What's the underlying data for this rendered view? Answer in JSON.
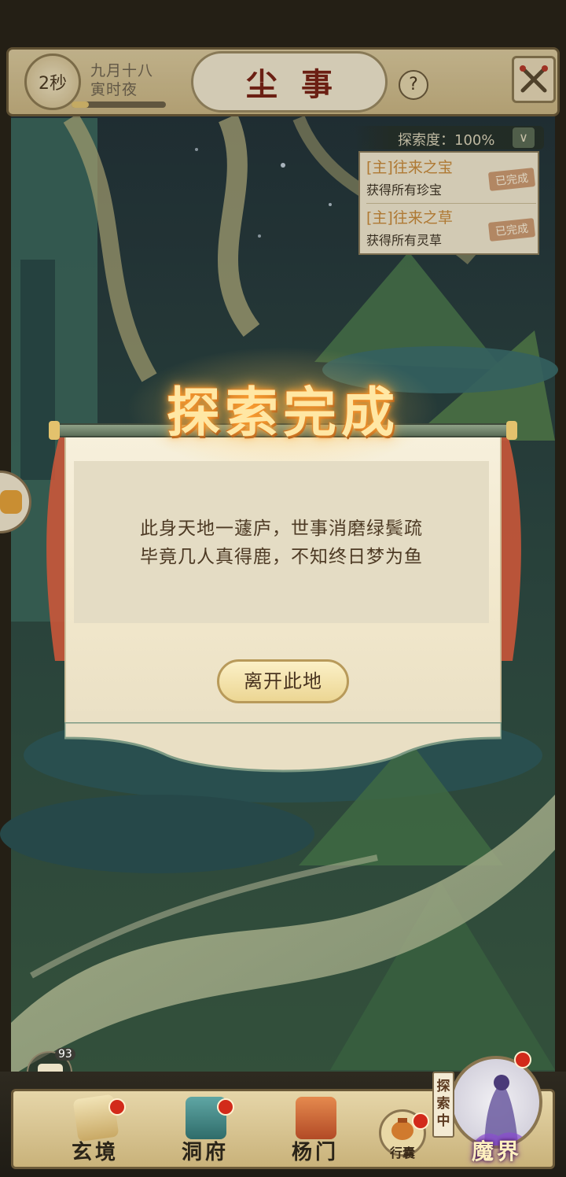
{
  "topbar": {
    "timer": "2秒",
    "date_line1": "九月十八",
    "date_line2": "寅时夜",
    "date_progress": 0.18,
    "title": "尘事",
    "help": "?"
  },
  "quest_panel": {
    "progress_label": "探索度：100%",
    "quests": [
      {
        "title": "[主]往来之宝",
        "desc": "获得所有珍宝",
        "status": "已完成"
      },
      {
        "title": "[主]往来之草",
        "desc": "获得所有灵草",
        "status": "已完成"
      }
    ]
  },
  "modal": {
    "title": "探索完成",
    "poem_line1": "此身天地一蘧庐，世事消磨绿鬓疏",
    "poem_line2": "毕竟几人真得鹿，不知终日梦为鱼",
    "leave_button": "离开此地"
  },
  "chat": {
    "badge": "93"
  },
  "bottom_nav": {
    "items": [
      {
        "label": "玄境"
      },
      {
        "label": "洞府"
      },
      {
        "label": "杨门"
      }
    ],
    "bag_label": "行囊",
    "exploring_tag": "探索中",
    "demon_realm_label": "魔界"
  },
  "icons": {
    "close": "crossed-swords-icon",
    "side_tab": "treasure-bag-icon",
    "chat": "chat-bubble-icon"
  }
}
